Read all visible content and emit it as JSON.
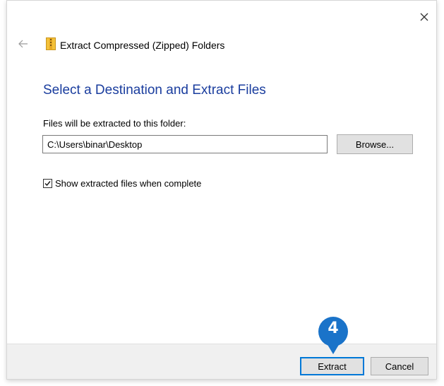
{
  "dialog": {
    "title": "Extract Compressed (Zipped) Folders",
    "heading": "Select a Destination and Extract Files",
    "folder_label": "Files will be extracted to this folder:",
    "path_value": "C:\\Users\\binar\\Desktop",
    "browse_label": "Browse...",
    "show_files_label": "Show extracted files when complete",
    "show_files_checked": true
  },
  "footer": {
    "extract_label": "Extract",
    "cancel_label": "Cancel"
  },
  "callout": {
    "step": "4",
    "color": "#1a73c9"
  },
  "icons": {
    "back": "back-arrow-icon",
    "close": "close-icon",
    "zip_folder": "zip-folder-icon",
    "check": "checkmark-icon"
  },
  "colors": {
    "heading": "#1a3d9e",
    "accent": "#0078d7",
    "footer_bg": "#f0f0f0"
  }
}
